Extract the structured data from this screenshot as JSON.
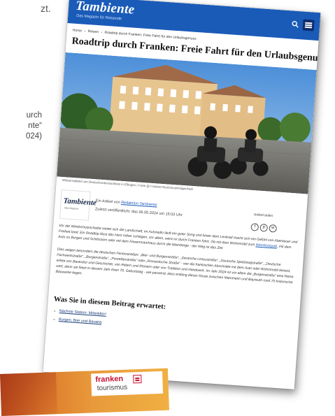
{
  "background": {
    "top_fragment": "zt.",
    "side_lines": [
      "urch",
      "nte“",
      "024)"
    ]
  },
  "site": {
    "logo": "Tambiente",
    "logo_sub": "Das Magazin für Reisende",
    "search_icon": "search-icon",
    "menu_icon": "hamburger-menu-icon",
    "brand_color": "#1a5bb8"
  },
  "breadcrumb": [
    "Home",
    "Reisen",
    "Roadtrip durch Franken: Freie Fahrt für den Urlaubsgenuss"
  ],
  "article": {
    "title": "Roadtrip durch Franken: Freie Fahrt für den Urlaubsgenuss",
    "photo_caption": "#Motorradfahrt am Deutschordensschloss in Ellingen / Freie @ FrankenTourismus/Holger/Hub",
    "author_logo": "Tambiente",
    "author_logo_sub": "Das Magazin",
    "author_prefix": "Ein Artikel von",
    "author_name": "Redaktion Tambiente",
    "published": "Zuletzt veröffentlicht: das 06.05.2024 um 15:03 Uhr",
    "share_label": "Artikel teilen",
    "share_icons": [
      "facebook-icon",
      "pinterest-icon",
      "whatsapp-icon"
    ],
    "paragraph1": "Vor der Windschutzscheibe weitet sich die Landschaft, im Autoradio läuft ein guter Song und hinter dem Lenkrad macht sich ein Gefühl von Abenteuer und Freiheit breit: Ein Roadtrip lässt das Herz höher schlagen, vor allem, wenn er durch Franken führt. Ob mit dem Wohnmobil zum",
    "paragraph1_link": "Weinfestspaß",
    "paragraph1_end": ", mit dem Auto zu Burgen und Schlössern oder mit dem Fewermotorhaus durch die Weinberge - der Weg ist das Ziel.",
    "paragraph2": "Dies zeigen besonders die deutschen Ferienstraßen: „Bier- und Burgenstraße“, „Deutsche Limesstraße“, „Deutsche Spielzeugstraße“, „Deutsche Fachwerkstraße“, „Burgenstraße“, „Porzellanstraße“ oder „Romantische Straße“ - wer die frankischen Abschnitte mit dem Auto oder Wohnmobil bereist, erlebt von Baukultur und Geschichte, von Rittern und Römern oder von Tradition und Handwerk. Im Jahr 2024 ist vor allem die „Burgenstraße“ eine Reise wert, denn sie feiert in diesem Jahr ihren 70. Geburtstag - wie passend, dass entlang dieser Route zwischen Mannheim und Bayreuth rund 70 historische Bauwerke liegen.",
    "section_title": "Was Sie in diesem Beitrag erwartet:",
    "toc": [
      "Nächste Station: Mittelalter!",
      "Burgen, Bier und Bavaria"
    ]
  },
  "banner": {
    "word1": "franken",
    "word2": "tourismus",
    "color": "#c6122f"
  }
}
